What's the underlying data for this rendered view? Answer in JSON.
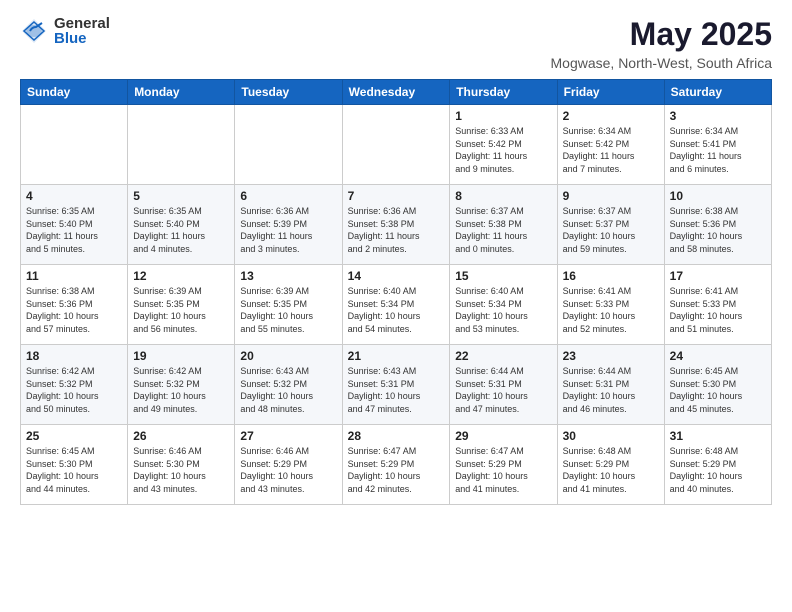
{
  "logo": {
    "general": "General",
    "blue": "Blue"
  },
  "header": {
    "month": "May 2025",
    "location": "Mogwase, North-West, South Africa"
  },
  "weekdays": [
    "Sunday",
    "Monday",
    "Tuesday",
    "Wednesday",
    "Thursday",
    "Friday",
    "Saturday"
  ],
  "weeks": [
    [
      {
        "day": "",
        "info": ""
      },
      {
        "day": "",
        "info": ""
      },
      {
        "day": "",
        "info": ""
      },
      {
        "day": "",
        "info": ""
      },
      {
        "day": "1",
        "info": "Sunrise: 6:33 AM\nSunset: 5:42 PM\nDaylight: 11 hours\nand 9 minutes."
      },
      {
        "day": "2",
        "info": "Sunrise: 6:34 AM\nSunset: 5:42 PM\nDaylight: 11 hours\nand 7 minutes."
      },
      {
        "day": "3",
        "info": "Sunrise: 6:34 AM\nSunset: 5:41 PM\nDaylight: 11 hours\nand 6 minutes."
      }
    ],
    [
      {
        "day": "4",
        "info": "Sunrise: 6:35 AM\nSunset: 5:40 PM\nDaylight: 11 hours\nand 5 minutes."
      },
      {
        "day": "5",
        "info": "Sunrise: 6:35 AM\nSunset: 5:40 PM\nDaylight: 11 hours\nand 4 minutes."
      },
      {
        "day": "6",
        "info": "Sunrise: 6:36 AM\nSunset: 5:39 PM\nDaylight: 11 hours\nand 3 minutes."
      },
      {
        "day": "7",
        "info": "Sunrise: 6:36 AM\nSunset: 5:38 PM\nDaylight: 11 hours\nand 2 minutes."
      },
      {
        "day": "8",
        "info": "Sunrise: 6:37 AM\nSunset: 5:38 PM\nDaylight: 11 hours\nand 0 minutes."
      },
      {
        "day": "9",
        "info": "Sunrise: 6:37 AM\nSunset: 5:37 PM\nDaylight: 10 hours\nand 59 minutes."
      },
      {
        "day": "10",
        "info": "Sunrise: 6:38 AM\nSunset: 5:36 PM\nDaylight: 10 hours\nand 58 minutes."
      }
    ],
    [
      {
        "day": "11",
        "info": "Sunrise: 6:38 AM\nSunset: 5:36 PM\nDaylight: 10 hours\nand 57 minutes."
      },
      {
        "day": "12",
        "info": "Sunrise: 6:39 AM\nSunset: 5:35 PM\nDaylight: 10 hours\nand 56 minutes."
      },
      {
        "day": "13",
        "info": "Sunrise: 6:39 AM\nSunset: 5:35 PM\nDaylight: 10 hours\nand 55 minutes."
      },
      {
        "day": "14",
        "info": "Sunrise: 6:40 AM\nSunset: 5:34 PM\nDaylight: 10 hours\nand 54 minutes."
      },
      {
        "day": "15",
        "info": "Sunrise: 6:40 AM\nSunset: 5:34 PM\nDaylight: 10 hours\nand 53 minutes."
      },
      {
        "day": "16",
        "info": "Sunrise: 6:41 AM\nSunset: 5:33 PM\nDaylight: 10 hours\nand 52 minutes."
      },
      {
        "day": "17",
        "info": "Sunrise: 6:41 AM\nSunset: 5:33 PM\nDaylight: 10 hours\nand 51 minutes."
      }
    ],
    [
      {
        "day": "18",
        "info": "Sunrise: 6:42 AM\nSunset: 5:32 PM\nDaylight: 10 hours\nand 50 minutes."
      },
      {
        "day": "19",
        "info": "Sunrise: 6:42 AM\nSunset: 5:32 PM\nDaylight: 10 hours\nand 49 minutes."
      },
      {
        "day": "20",
        "info": "Sunrise: 6:43 AM\nSunset: 5:32 PM\nDaylight: 10 hours\nand 48 minutes."
      },
      {
        "day": "21",
        "info": "Sunrise: 6:43 AM\nSunset: 5:31 PM\nDaylight: 10 hours\nand 47 minutes."
      },
      {
        "day": "22",
        "info": "Sunrise: 6:44 AM\nSunset: 5:31 PM\nDaylight: 10 hours\nand 47 minutes."
      },
      {
        "day": "23",
        "info": "Sunrise: 6:44 AM\nSunset: 5:31 PM\nDaylight: 10 hours\nand 46 minutes."
      },
      {
        "day": "24",
        "info": "Sunrise: 6:45 AM\nSunset: 5:30 PM\nDaylight: 10 hours\nand 45 minutes."
      }
    ],
    [
      {
        "day": "25",
        "info": "Sunrise: 6:45 AM\nSunset: 5:30 PM\nDaylight: 10 hours\nand 44 minutes."
      },
      {
        "day": "26",
        "info": "Sunrise: 6:46 AM\nSunset: 5:30 PM\nDaylight: 10 hours\nand 43 minutes."
      },
      {
        "day": "27",
        "info": "Sunrise: 6:46 AM\nSunset: 5:29 PM\nDaylight: 10 hours\nand 43 minutes."
      },
      {
        "day": "28",
        "info": "Sunrise: 6:47 AM\nSunset: 5:29 PM\nDaylight: 10 hours\nand 42 minutes."
      },
      {
        "day": "29",
        "info": "Sunrise: 6:47 AM\nSunset: 5:29 PM\nDaylight: 10 hours\nand 41 minutes."
      },
      {
        "day": "30",
        "info": "Sunrise: 6:48 AM\nSunset: 5:29 PM\nDaylight: 10 hours\nand 41 minutes."
      },
      {
        "day": "31",
        "info": "Sunrise: 6:48 AM\nSunset: 5:29 PM\nDaylight: 10 hours\nand 40 minutes."
      }
    ]
  ]
}
